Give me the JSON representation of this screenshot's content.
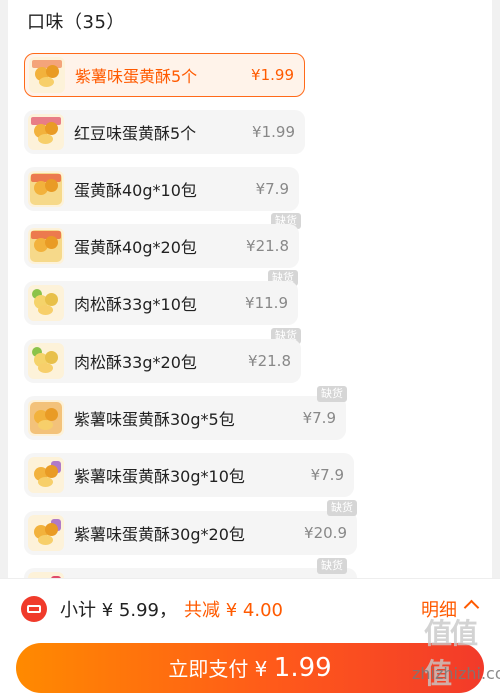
{
  "section": {
    "title": "口味（35）"
  },
  "options": [
    {
      "label": "紫薯味蛋黄酥5个",
      "price": "¥1.99",
      "thumb": "purple-yolk-pastry-icon",
      "selected": true,
      "badge": ""
    },
    {
      "label": "红豆味蛋黄酥5个",
      "price": "¥1.99",
      "thumb": "red-bean-yolk-pastry-icon",
      "selected": false,
      "badge": ""
    },
    {
      "label": "蛋黄酥40g*10包",
      "price": "¥7.9",
      "thumb": "yolk-pastry-box-icon",
      "selected": false,
      "badge": "缺货"
    },
    {
      "label": "蛋黄酥40g*20包",
      "price": "¥21.8",
      "thumb": "yolk-pastry-box-icon",
      "selected": false,
      "badge": "缺货"
    },
    {
      "label": "肉松酥33g*10包",
      "price": "¥11.9",
      "thumb": "pork-floss-pastry-icon",
      "selected": false,
      "badge": "缺货"
    },
    {
      "label": "肉松酥33g*20包",
      "price": "¥21.8",
      "thumb": "pork-floss-pastry-icon",
      "selected": false,
      "badge": ""
    },
    {
      "label": "紫薯味蛋黄酥30g*5包",
      "price": "¥7.9",
      "thumb": "purple-yolk-pastry-icon",
      "selected": false,
      "badge": "缺货"
    },
    {
      "label": "紫薯味蛋黄酥30g*10包",
      "price": "¥7.9",
      "thumb": "purple-yolk-pastry-icon",
      "selected": false,
      "badge": ""
    },
    {
      "label": "紫薯味蛋黄酥30g*20包",
      "price": "¥20.9",
      "thumb": "purple-yolk-pastry-icon",
      "selected": false,
      "badge": "缺货"
    },
    {
      "label": "",
      "price": "",
      "thumb": "purple-yolk-pastry-icon",
      "selected": false,
      "badge": "缺货"
    }
  ],
  "bottom": {
    "coupon_icon": "coupon-ticket-icon",
    "subtotal": "小计 ¥ 5.99，",
    "discount": "共减 ¥ 4.00",
    "detail": "明细",
    "pay_label": "立即支付 ¥ ",
    "pay_amount": "1.99"
  },
  "watermark": {
    "text": "zhizhizhi.com",
    "glyphs": "值值值"
  },
  "colors": {
    "accent": "#ff5a00",
    "selected_bg": "#fff3ea",
    "badge": "#d6d6d6",
    "pay_start": "#ff8a00",
    "pay_end": "#f23a2a"
  }
}
